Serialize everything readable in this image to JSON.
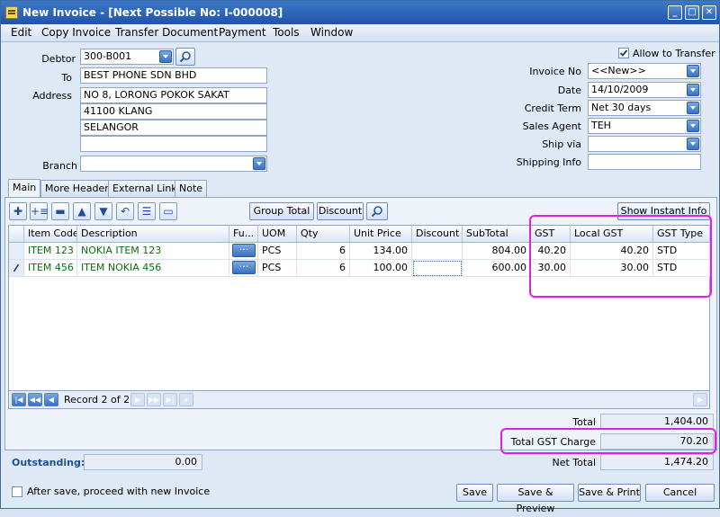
{
  "window": {
    "title": "New Invoice - [Next Possible No: I-000008]"
  },
  "menu": [
    "Edit",
    "Copy Invoice",
    "Transfer Document",
    "Payment",
    "Tools",
    "Window"
  ],
  "left_form": {
    "debtor_label": "Debtor",
    "debtor": "300-B001",
    "to_label": "To",
    "to": "BEST PHONE SDN BHD",
    "address_label": "Address",
    "address": [
      "NO 8, LORONG POKOK SAKAT",
      "41100 KLANG",
      "SELANGOR",
      ""
    ],
    "branch_label": "Branch",
    "branch": ""
  },
  "right_form": {
    "allow_transfer": "Allow to Transfer",
    "invoice_no_label": "Invoice No",
    "invoice_no": "<<New>>",
    "date_label": "Date",
    "date": "14/10/2009",
    "credit_term_label": "Credit Term",
    "credit_term": "Net 30 days",
    "sales_agent_label": "Sales Agent",
    "sales_agent": "TEH",
    "ship_via_label": "Ship via",
    "ship_via": "",
    "shipping_info_label": "Shipping Info",
    "shipping_info": ""
  },
  "tabs": [
    "Main",
    "More Header",
    "External Link",
    "Note"
  ],
  "toolbar": {
    "group_total": "Group Total",
    "discount": "Discount",
    "show_instant_info": "Show Instant Info"
  },
  "grid": {
    "columns": [
      "Item Code",
      "Description",
      "Fu...",
      "UOM",
      "Qty",
      "Unit Price",
      "Discount",
      "SubTotal",
      "GST",
      "Local GST",
      "GST Type"
    ],
    "rows": [
      {
        "item_code": "ITEM 123",
        "description": "NOKIA ITEM 123",
        "uom": "PCS",
        "qty": "6",
        "unit_price": "134.00",
        "discount": "",
        "subtotal": "804.00",
        "gst": "40.20",
        "local_gst": "40.20",
        "gst_type": "STD"
      },
      {
        "item_code": "ITEM 456",
        "description": "ITEM NOKIA 456",
        "uom": "PCS",
        "qty": "6",
        "unit_price": "100.00",
        "discount": "",
        "subtotal": "600.00",
        "gst": "30.00",
        "local_gst": "30.00",
        "gst_type": "STD"
      }
    ],
    "row_button": "···"
  },
  "navigator": {
    "record_text": "Record 2 of 2"
  },
  "totals": {
    "total_label": "Total",
    "total": "1,404.00",
    "gst_charge_label": "Total GST Charge",
    "gst_charge": "70.20",
    "net_total_label": "Net Total",
    "net_total": "1,474.20",
    "outstanding_label": "Outstanding:",
    "outstanding": "0.00"
  },
  "footer": {
    "proceed_label": "After save, proceed with new Invoice",
    "save": "Save",
    "save_preview": "Save & Preview",
    "save_print": "Save & Print",
    "cancel": "Cancel"
  },
  "colors": {
    "highlight": "#e020e0",
    "title_bar": "#2a62b8",
    "item_text": "#0a6e0a",
    "outstanding": "#1f4f9a"
  }
}
